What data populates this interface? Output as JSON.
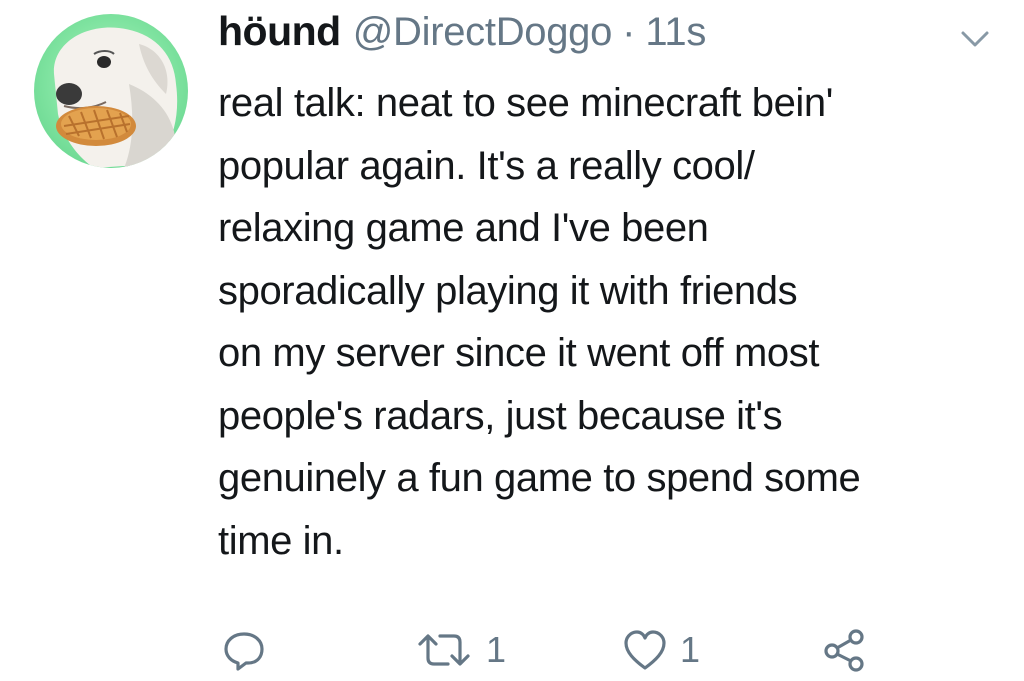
{
  "tweet": {
    "display_name": "höund",
    "handle": "@DirectDoggo",
    "separator": "·",
    "timestamp": "11s",
    "text": "real talk: neat to see minecraft bein'\npopular again. It's a really cool/\nrelaxing game and I've been\nsporadically playing it with friends\non my server since it went off most\npeople's radars, just because it's\ngenuinely a fun game to spend some\ntime in.",
    "avatar": {
      "description_icon": "dog-with-waffle-avatar",
      "background_color": "#7fe3a0"
    }
  },
  "actions": {
    "reply": {
      "icon": "reply-icon"
    },
    "retweet": {
      "icon": "retweet-icon",
      "count": "1"
    },
    "like": {
      "icon": "heart-icon",
      "count": "1"
    },
    "share": {
      "icon": "share-icon"
    }
  },
  "colors": {
    "text": "#14171a",
    "secondary": "#657786",
    "background": "#ffffff"
  }
}
